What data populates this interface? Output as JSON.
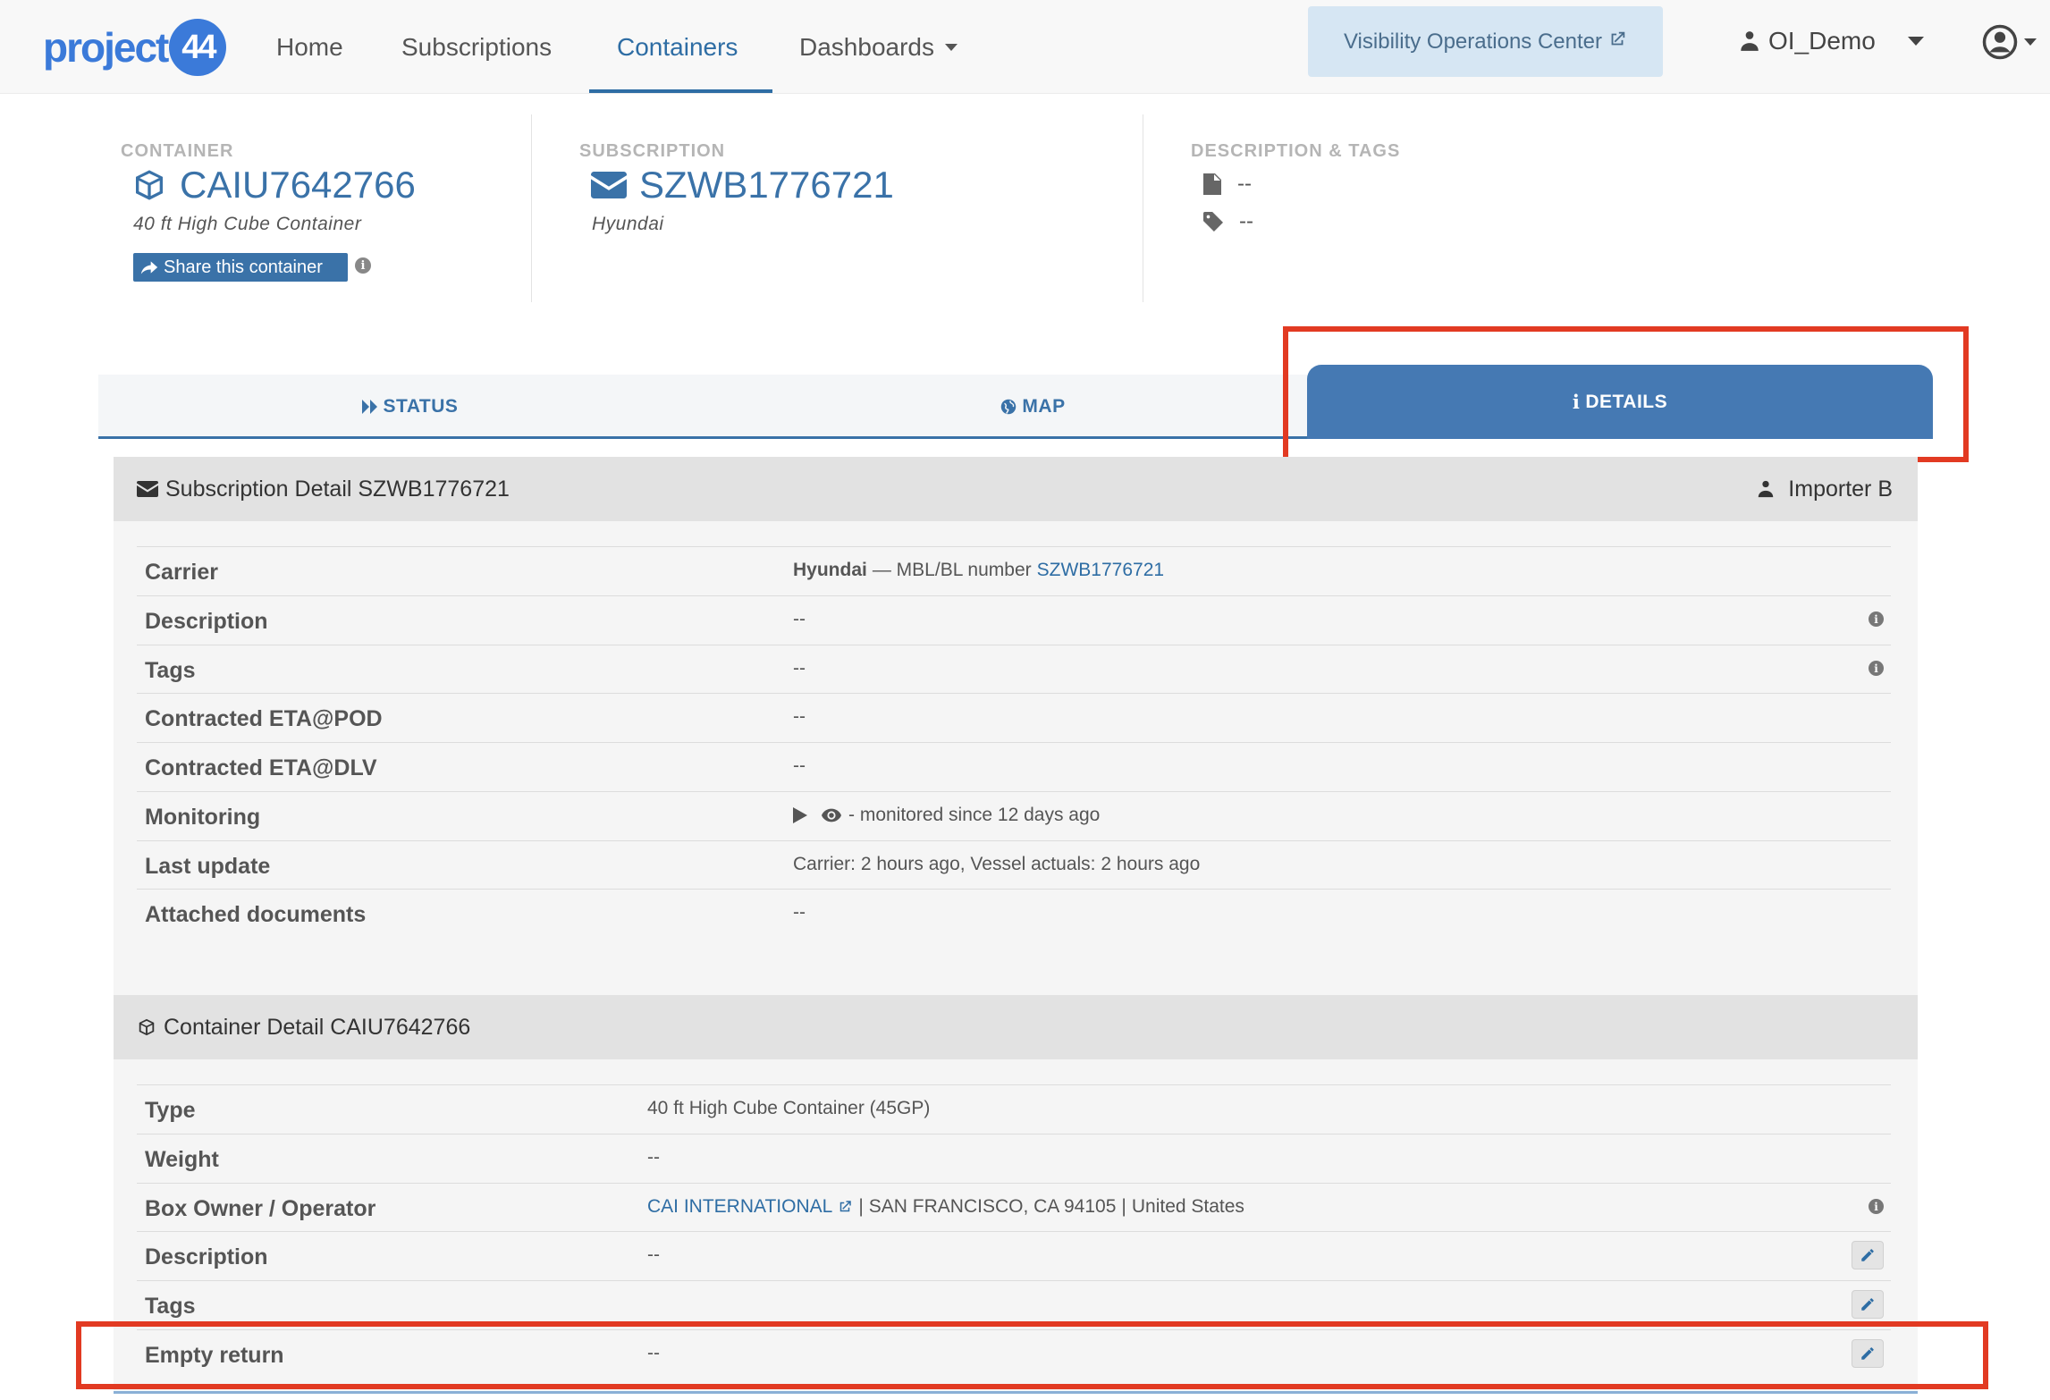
{
  "nav": {
    "logo_text": "project",
    "logo_badge": "44",
    "items": [
      "Home",
      "Subscriptions",
      "Containers",
      "Dashboards"
    ],
    "voc_button": "Visibility Operations Center",
    "user": "OI_Demo"
  },
  "header": {
    "container_label": "CONTAINER",
    "container_id": "CAIU7642766",
    "container_type": "40 ft High Cube Container",
    "share_button": "Share this container",
    "subscription_label": "SUBSCRIPTION",
    "subscription_id": "SZWB1776721",
    "subscription_carrier": "Hyundai",
    "desc_tags_label": "DESCRIPTION & TAGS",
    "description": "--",
    "tags": "--"
  },
  "tabs": [
    "STATUS",
    "MAP",
    "DETAILS"
  ],
  "subscription_detail": {
    "title": "Subscription Detail SZWB1776721",
    "importer": "Importer B",
    "rows": {
      "carrier_label": "Carrier",
      "carrier_name": "Hyundai",
      "carrier_mbl_text": "— MBL/BL number",
      "carrier_mbl": "SZWB1776721",
      "description_label": "Description",
      "description_value": "--",
      "tags_label": "Tags",
      "tags_value": "--",
      "eta_pod_label": "Contracted ETA@POD",
      "eta_pod_value": "--",
      "eta_dlv_label": "Contracted ETA@DLV",
      "eta_dlv_value": "--",
      "monitoring_label": "Monitoring",
      "monitoring_value": "- monitored since 12 days ago",
      "last_update_label": "Last update",
      "last_update_value": "Carrier: 2 hours ago, Vessel actuals: 2 hours ago",
      "attached_label": "Attached documents",
      "attached_value": "--"
    }
  },
  "container_detail": {
    "title": "Container Detail CAIU7642766",
    "rows": {
      "type_label": "Type",
      "type_value": "40 ft High Cube Container (45GP)",
      "weight_label": "Weight",
      "weight_value": "--",
      "owner_label": "Box Owner / Operator",
      "owner_name": "CAI INTERNATIONAL",
      "owner_city": "SAN FRANCISCO, CA 94105",
      "owner_country": "United States",
      "description_label": "Description",
      "description_value": "--",
      "tags_label": "Tags",
      "empty_return_label": "Empty return",
      "empty_return_value": "--"
    }
  },
  "colors": {
    "brand": "#3b7ad9",
    "link": "#2e6da4",
    "active_tab": "#4579b3",
    "highlight": "#e23a22"
  }
}
